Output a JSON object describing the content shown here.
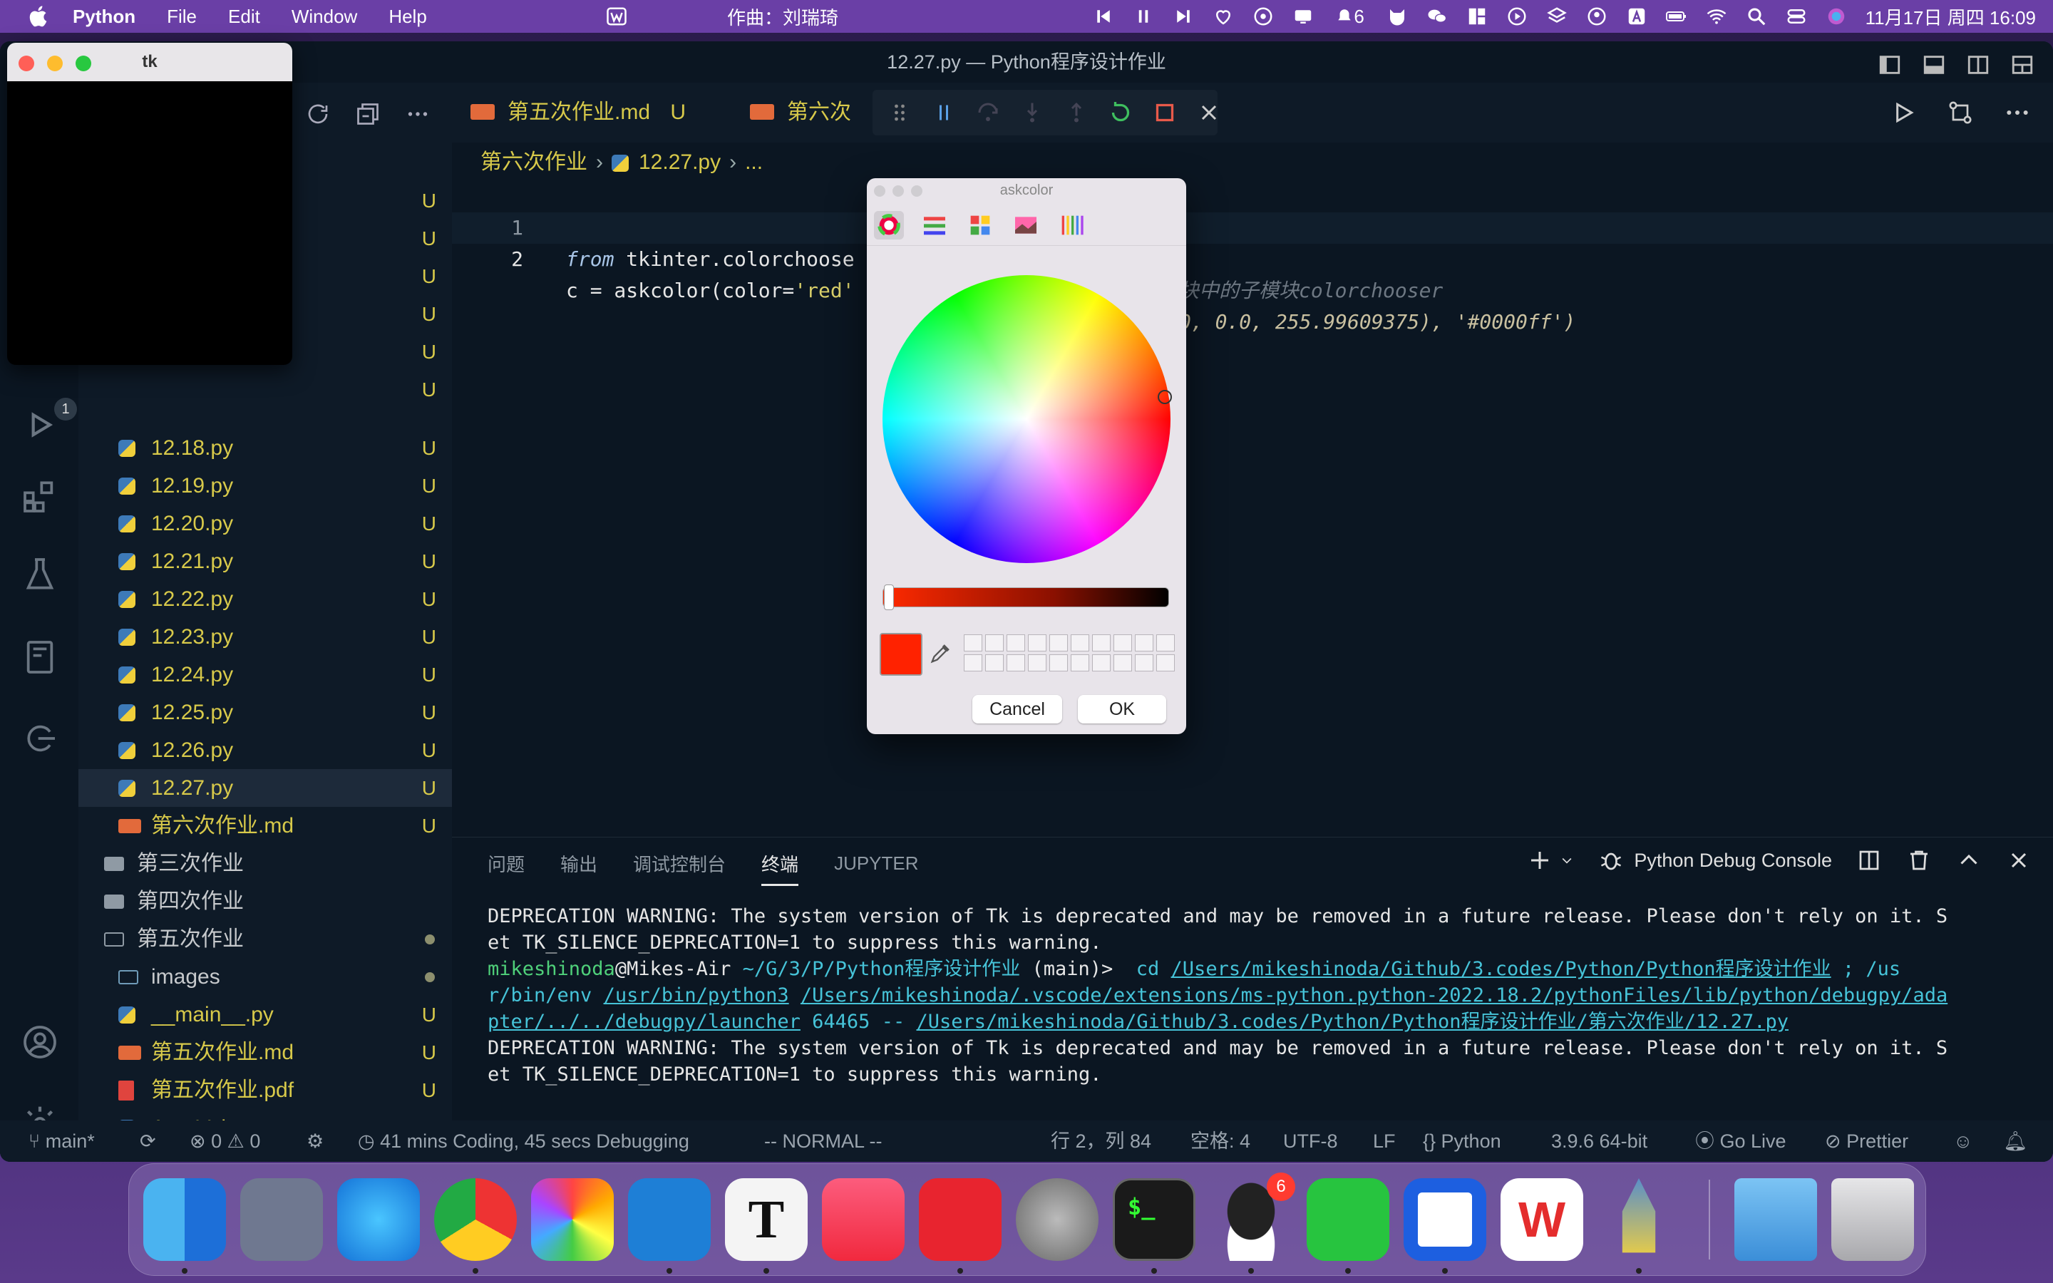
{
  "menubar": {
    "app_name": "Python",
    "menus": [
      "File",
      "Edit",
      "Window",
      "Help"
    ],
    "now_playing": "作曲：刘瑞琦",
    "notification_count": "6",
    "clock": "11月17日 周四  16:09"
  },
  "window": {
    "title": "12.27.py — Python程序设计作业"
  },
  "activity": {
    "debug_badge": "1"
  },
  "sidebar": {
    "files": [
      {
        "name": "12.18.py",
        "status": "U",
        "type": "py"
      },
      {
        "name": "12.19.py",
        "status": "U",
        "type": "py"
      },
      {
        "name": "12.20.py",
        "status": "U",
        "type": "py"
      },
      {
        "name": "12.21.py",
        "status": "U",
        "type": "py"
      },
      {
        "name": "12.22.py",
        "status": "U",
        "type": "py"
      },
      {
        "name": "12.23.py",
        "status": "U",
        "type": "py"
      },
      {
        "name": "12.24.py",
        "status": "U",
        "type": "py"
      },
      {
        "name": "12.25.py",
        "status": "U",
        "type": "py"
      },
      {
        "name": "12.26.py",
        "status": "U",
        "type": "py"
      },
      {
        "name": "12.27.py",
        "status": "U",
        "type": "py"
      },
      {
        "name": "第六次作业.md",
        "status": "U",
        "type": "md"
      },
      {
        "name": "第三次作业",
        "status": "",
        "type": "folder"
      },
      {
        "name": "第四次作业",
        "status": "",
        "type": "folder"
      },
      {
        "name": "第五次作业",
        "status": "",
        "type": "folder-open"
      },
      {
        "name": "images",
        "status": "",
        "type": "folder-img"
      },
      {
        "name": "__main__.py",
        "status": "U",
        "type": "py"
      },
      {
        "name": "第五次作业.md",
        "status": "U",
        "type": "md"
      },
      {
        "name": "第五次作业.pdf",
        "status": "U",
        "type": "pdf"
      },
      {
        "name": "AreaVolume.py",
        "status": "U",
        "type": "py"
      },
      {
        "name": "MyMath.py",
        "status": "U",
        "type": "py"
      }
    ],
    "hidden_status": [
      "U",
      "U",
      "U",
      "U",
      "U",
      "U"
    ]
  },
  "tabs": [
    {
      "label": "第五次作业.md",
      "status": "U"
    },
    {
      "label": "第六次作"
    }
  ],
  "breadcrumb": {
    "folder": "第六次作业",
    "file": "12.27.py",
    "rest": "..."
  },
  "editor": {
    "line1_no": "1",
    "line2_no": "2",
    "line1_kw": "from",
    "line1_code": " tkinter.colorchoose",
    "line1_comment": "块中的子模块colorchooser",
    "line2_code": "c = askcolor(color=",
    "line2_str": "'red'",
    "line2_tail": "0, 0.0, 255.99609375), '#0000ff')"
  },
  "panel": {
    "tabs": [
      "问题",
      "输出",
      "调试控制台",
      "终端",
      "JUPYTER"
    ],
    "active_tab": "终端",
    "console_name": "Python Debug Console"
  },
  "terminal": {
    "warn1a": "DEPRECATION WARNING: The system version of Tk is deprecated and may be removed in a future release. Please don't rely on it. S",
    "warn1b": "et TK_SILENCE_DEPRECATION=1 to suppress this warning.",
    "user": "mikeshinoda",
    "host": "@Mikes-Air ",
    "path": "~/G/3/P/Python程序设计作业",
    "branch": " (main)>  ",
    "cmd1": "cd ",
    "cmd_path1": "/Users/mikeshinoda/Github/3.codes/Python/Python程序设计作业",
    "cmd_sep": " ; /us",
    "line3a": "r/bin/env ",
    "line3b": "/usr/bin/python3",
    "line3c": " ",
    "line3d": "/Users/mikeshinoda/.vscode/extensions/ms-python.python-2022.18.2/pythonFiles/lib/python/debugpy/ada",
    "line4a": "pter/../../debugpy/launcher",
    "line4b": " 64465 -- ",
    "line4c": "/Users/mikeshinoda/Github/3.codes/Python/Python程序设计作业/第六次作业/12.27.py",
    "warn2a": "DEPRECATION WARNING: The system version of Tk is deprecated and may be removed in a future release. Please don't rely on it. S",
    "warn2b": "et TK_SILENCE_DEPRECATION=1 to suppress this warning."
  },
  "statusbar": {
    "branch": "main*",
    "errors": "0",
    "warnings": "0",
    "wakatime": "41 mins Coding, 45 secs Debugging",
    "vim_mode": "-- NORMAL --",
    "position": "行 2，列 84",
    "spaces": "空格: 4",
    "encoding": "UTF-8",
    "eol": "LF",
    "language": "Python",
    "interpreter": "3.9.6 64-bit",
    "golive": "Go Live",
    "prettier": "Prettier"
  },
  "tk_window": {
    "title": "tk"
  },
  "askcolor": {
    "title": "askcolor",
    "selected_color": "#ff2200",
    "cancel_label": "Cancel",
    "ok_label": "OK"
  },
  "dock": {
    "apps": [
      "Finder",
      "Launchpad",
      "Safari",
      "Chrome",
      "Photos",
      "VS Code",
      "Typora",
      "Music",
      "NetEase Music",
      "System Preferences",
      "Terminal",
      "QQ",
      "WeChat",
      "Lark",
      "WPS",
      "Python Launcher",
      "Downloads",
      "Trash"
    ],
    "qq_badge": "6"
  },
  "colors": {
    "accent_yellow": "#d7c94a",
    "editor_bg": "#0b1622",
    "terminal_green": "#4fd07a",
    "terminal_cyan": "#46c3d8",
    "menubar_bg": "#6a3fa6"
  }
}
